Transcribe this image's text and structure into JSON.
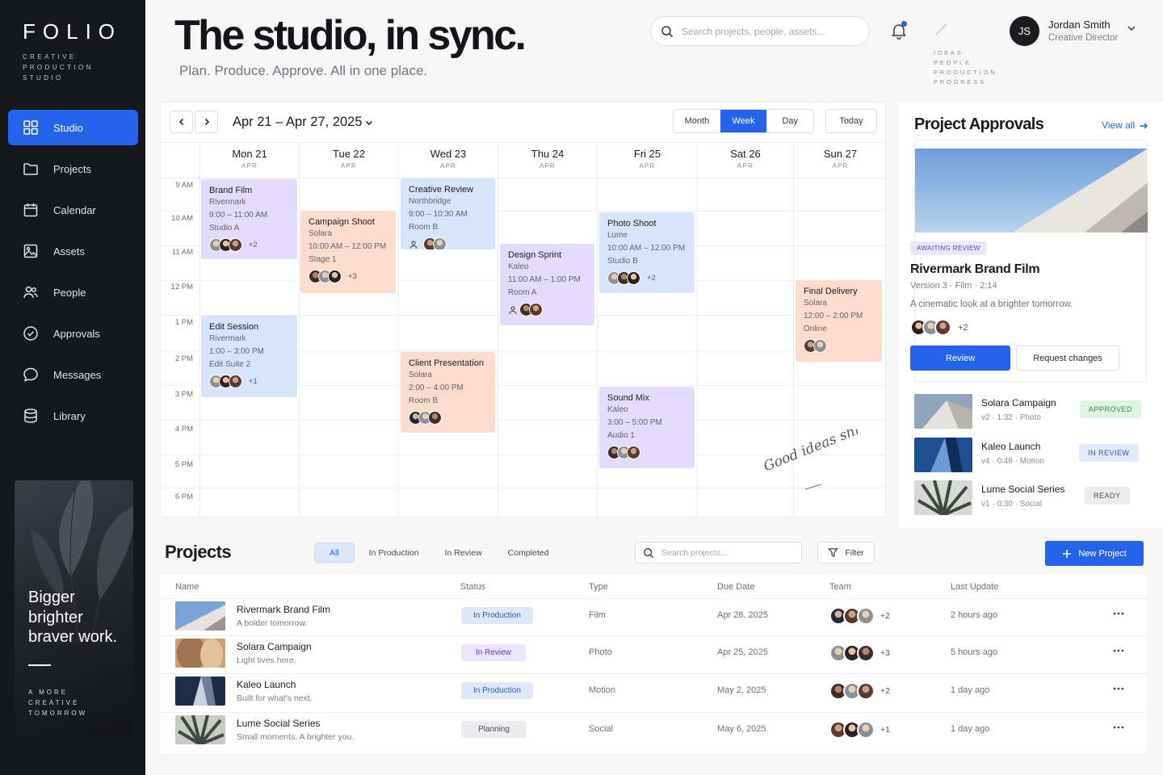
{
  "brand": {
    "logo": "FOLIO",
    "tagline": "CREATIVE PRODUCTION STUDIO"
  },
  "sidebar": {
    "items": [
      {
        "label": "Studio",
        "icon": "grid-icon",
        "active": true
      },
      {
        "label": "Projects",
        "icon": "folder-icon"
      },
      {
        "label": "Calendar",
        "icon": "calendar-icon"
      },
      {
        "label": "Assets",
        "icon": "image-icon"
      },
      {
        "label": "People",
        "icon": "people-icon"
      },
      {
        "label": "Approvals",
        "icon": "check-circle-icon"
      },
      {
        "label": "Messages",
        "icon": "chat-icon"
      },
      {
        "label": "Library",
        "icon": "database-icon"
      }
    ],
    "promo": {
      "title": "Bigger brighter braver work.",
      "subtitle": "A MORE CREATIVE TOMORROW"
    }
  },
  "header": {
    "title": "The studio, in sync.",
    "subtitle": "Plan. Produce. Approve. All in one place.",
    "search_placeholder": "Search projects, people, assets...",
    "tagwords": [
      "IDEAS",
      "PEOPLE",
      "PRODUCTION",
      "PROGRESS"
    ],
    "user": {
      "initials": "JS",
      "name": "Jordan Smith",
      "role": "Creative Director"
    }
  },
  "calendar": {
    "range": "Apr 21 – Apr 27, 2025",
    "views": [
      "Month",
      "Week",
      "Day"
    ],
    "active_view": "Week",
    "today_label": "Today",
    "days": [
      {
        "name": "Mon 21",
        "month": "APR"
      },
      {
        "name": "Tue 22",
        "month": "APR"
      },
      {
        "name": "Wed 23",
        "month": "APR"
      },
      {
        "name": "Thu 24",
        "month": "APR"
      },
      {
        "name": "Fri 25",
        "month": "APR"
      },
      {
        "name": "Sat 26",
        "month": "APR"
      },
      {
        "name": "Sun 27",
        "month": "APR"
      }
    ],
    "times": [
      "9 AM",
      "10 AM",
      "11 AM",
      "12 PM",
      "1 PM",
      "2 PM",
      "3 PM",
      "4 PM",
      "5 PM",
      "6 PM"
    ],
    "events": [
      {
        "title": "Brand Film",
        "client": "Rivermark",
        "time": "9:00 – 11:00 AM",
        "place": "Studio A",
        "more": "+2"
      },
      {
        "title": "Campaign Shoot",
        "client": "Solara",
        "time": "10:00 AM – 12:00 PM",
        "place": "Stage 1",
        "more": "+3"
      },
      {
        "title": "Creative Review",
        "client": "Northbridge",
        "time": "9:00 – 10:30 AM",
        "place": "Room B",
        "more": ""
      },
      {
        "title": "Design Sprint",
        "client": "Kaleo",
        "time": "11:00 AM – 1:00 PM",
        "place": "Room A",
        "more": ""
      },
      {
        "title": "Photo Shoot",
        "client": "Lume",
        "time": "10:00 AM – 12:00 PM",
        "place": "Studio B",
        "more": "+2"
      },
      {
        "title": "Final Delivery",
        "client": "Solara",
        "time": "12:00 – 2:00 PM",
        "place": "Online",
        "more": ""
      },
      {
        "title": "Edit Session",
        "client": "Rivermark",
        "time": "1:00 – 3:00 PM",
        "place": "Edit Suite 2",
        "more": "+1"
      },
      {
        "title": "Client Presentation",
        "client": "Solara",
        "time": "2:00 – 4:00 PM",
        "place": "Room B",
        "more": ""
      },
      {
        "title": "Sound Mix",
        "client": "Kaleo",
        "time": "3:00 – 5:00 PM",
        "place": "Audio 1",
        "more": ""
      }
    ],
    "script_note": "Good ideas ship."
  },
  "approvals": {
    "title": "Project Approvals",
    "view_all": "View all",
    "featured": {
      "badge": "AWAITING REVIEW",
      "name": "Rivermark Brand Film",
      "meta": "Version 3  ·  Film  ·  2:14",
      "desc": "A cinematic look at a brighter tomorrow.",
      "more": "+2",
      "review_label": "Review",
      "changes_label": "Request changes"
    },
    "items": [
      {
        "name": "Solara Campaign",
        "meta": "v2  ·  1:32  ·  Photo",
        "status": "APPROVED"
      },
      {
        "name": "Kaleo Launch",
        "meta": "v4  ·  0:48  ·  Motion",
        "status": "IN REVIEW"
      },
      {
        "name": "Lume Social Series",
        "meta": "v1  ·  0:30  ·  Social",
        "status": "READY"
      }
    ]
  },
  "projects": {
    "title": "Projects",
    "tabs": [
      "All",
      "In Production",
      "In Review",
      "Completed"
    ],
    "active_tab": "All",
    "search_placeholder": "Search projects...",
    "filter_label": "Filter",
    "new_label": "New Project",
    "columns": [
      "Name",
      "Status",
      "Type",
      "Due Date",
      "Team",
      "Last Update"
    ],
    "rows": [
      {
        "name": "Rivermark Brand Film",
        "desc": "A bolder tomorrow.",
        "status": "In Production",
        "type": "Film",
        "due": "Apr 28, 2025",
        "team_more": "+2",
        "updated": "2 hours ago"
      },
      {
        "name": "Solara Campaign",
        "desc": "Light lives here.",
        "status": "In Review",
        "type": "Photo",
        "due": "Apr 25, 2025",
        "team_more": "+3",
        "updated": "5 hours ago"
      },
      {
        "name": "Kaleo Launch",
        "desc": "Built for what's next.",
        "status": "In Production",
        "type": "Motion",
        "due": "May 2, 2025",
        "team_more": "+2",
        "updated": "1 day ago"
      },
      {
        "name": "Lume Social Series",
        "desc": "Small moments. A brighter you.",
        "status": "Planning",
        "type": "Social",
        "due": "May 6, 2025",
        "team_more": "+1",
        "updated": "1 day ago"
      }
    ]
  },
  "colors": {
    "accent": "#2563eb",
    "sidebar": "#17181c",
    "purple_event": "#e3dbfb",
    "peach_event": "#fcdccc",
    "blue_event": "#d7e4fb"
  }
}
